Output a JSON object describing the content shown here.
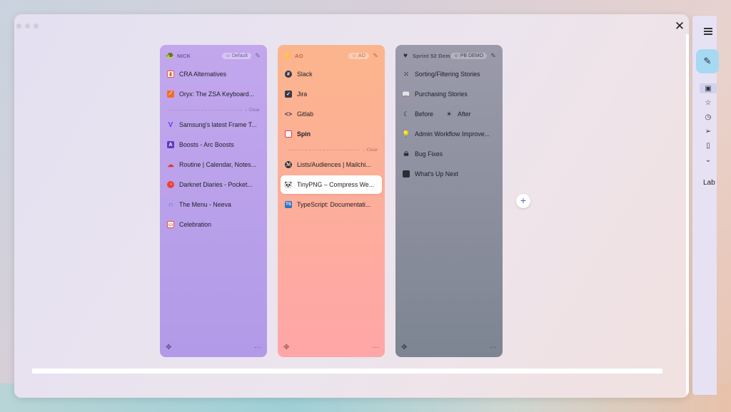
{
  "window": {
    "close_label": "✕"
  },
  "spaces": [
    {
      "name": "NICK",
      "icon": "turtle-icon",
      "profile": "Default",
      "pinned": [
        {
          "label": "CRA Alternatives",
          "icon": "chart-favicon",
          "color": "#e25a3a"
        },
        {
          "label": "Oryx: The ZSA Keyboard...",
          "icon": "oryx-favicon",
          "color": "#f06d2a"
        }
      ],
      "clear_label": "↓ Clear",
      "tabs": [
        {
          "label": "Samsung's latest Frame T...",
          "icon": "verge-favicon",
          "color": "#6d3bf5"
        },
        {
          "label": "Boosts - Arc Boosts",
          "icon": "arc-favicon",
          "color": "#5b3cc4"
        },
        {
          "label": "Routine | Calendar, Notes...",
          "icon": "routine-favicon",
          "color": "#e2352c"
        },
        {
          "label": "Darknet Diaries - Pocket...",
          "icon": "pocketcasts-favicon",
          "color": "#f43e37"
        },
        {
          "label": "The Menu - Neeva",
          "icon": "neeva-favicon",
          "color": "#2f6fde"
        },
        {
          "label": "Celebration",
          "icon": "celebration-favicon",
          "color": "#e84a3f"
        }
      ]
    },
    {
      "name": "AO",
      "icon": "bolt-icon",
      "profile": "AO",
      "pinned": [
        {
          "label": "Slack",
          "icon": "slack-favicon",
          "color": "#3a3a48"
        },
        {
          "label": "Jira",
          "icon": "jira-favicon",
          "color": "#3a3a48"
        },
        {
          "label": "Gitlab",
          "icon": "gitlab-favicon",
          "color": "#3a3a48"
        },
        {
          "label": "Spin",
          "icon": "folder-icon",
          "color": "#e8384a",
          "bold": true
        }
      ],
      "clear_label": "↓ Clear",
      "tabs": [
        {
          "label": "Lists/Audiences | Mailchi...",
          "icon": "mailchimp-favicon",
          "color": "#2b2b2b"
        },
        {
          "label": "TinyPNG – Compress We...",
          "icon": "tinypng-favicon",
          "color": "#6b7b4e",
          "active": true
        },
        {
          "label": "TypeScript: Documentati...",
          "icon": "typescript-favicon",
          "color": "#2f74c0"
        }
      ]
    },
    {
      "name": "Sprint 52 Demo",
      "icon": "heart-icon",
      "profile": "PB DEMO",
      "tabs": [
        {
          "label": "Sorting/Filtering Stories",
          "icon": "grid-icon"
        },
        {
          "label": "Purchasing Stories",
          "icon": "book-icon"
        },
        {
          "label": "Admin Workflow Improve...",
          "icon": "bulb-icon"
        },
        {
          "label": "Bug Fixes",
          "icon": "skull-icon"
        },
        {
          "label": "What's Up Next",
          "icon": "briefcase-icon"
        }
      ],
      "before_label": "Before",
      "after_label": "After"
    }
  ],
  "add_space_label": "+",
  "side_panel": {
    "label": "Lab",
    "icons": [
      "menu-icon",
      "compose-icon",
      "inbox-icon",
      "star-icon",
      "clock-icon",
      "send-icon",
      "document-icon",
      "chevron-down-icon"
    ]
  }
}
